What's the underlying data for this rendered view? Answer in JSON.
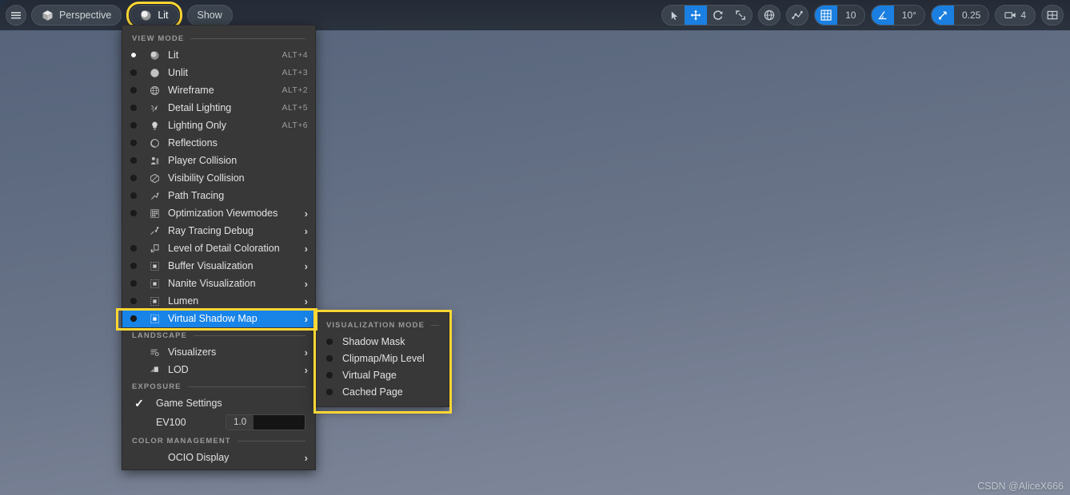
{
  "toolbar": {
    "menu_icon": "hamburger-icon",
    "perspective_label": "Perspective",
    "view_mode_label": "Lit",
    "show_label": "Show",
    "transform": {
      "select_icon": "cursor-arrow-icon",
      "move_icon": "move-gizmo-icon",
      "rotate_icon": "rotate-gizmo-icon",
      "scale_icon": "scale-gizmo-icon"
    },
    "coord_system_icon": "globe-icon",
    "surface_snap_icon": "surface-snapping-icon",
    "grid_snap": {
      "icon": "grid-icon",
      "value": "10"
    },
    "angle_snap": {
      "icon": "angle-icon",
      "value": "10°"
    },
    "scale_snap": {
      "icon": "scale-snap-icon",
      "value": "0.25"
    },
    "camera_speed": {
      "icon": "camera-icon",
      "value": "4"
    },
    "layout_icon": "viewport-layout-icon"
  },
  "view_menu": {
    "sections": [
      {
        "id": "view_mode",
        "title": "VIEW MODE"
      },
      {
        "id": "landscape",
        "title": "LANDSCAPE"
      },
      {
        "id": "exposure",
        "title": "EXPOSURE"
      },
      {
        "id": "color_management",
        "title": "COLOR MANAGEMENT"
      }
    ],
    "view_mode_items": [
      {
        "label": "Lit",
        "shortcut": "ALT+4",
        "icon": "lit-sphere-icon",
        "radio": true,
        "selected": true,
        "submenu": false
      },
      {
        "label": "Unlit",
        "shortcut": "ALT+3",
        "icon": "unlit-sphere-icon",
        "radio": true,
        "selected": false,
        "submenu": false
      },
      {
        "label": "Wireframe",
        "shortcut": "ALT+2",
        "icon": "wireframe-globe-icon",
        "radio": true,
        "selected": false,
        "submenu": false
      },
      {
        "label": "Detail Lighting",
        "shortcut": "ALT+5",
        "icon": "detail-lighting-icon",
        "radio": true,
        "selected": false,
        "submenu": false
      },
      {
        "label": "Lighting Only",
        "shortcut": "ALT+6",
        "icon": "lightbulb-icon",
        "radio": true,
        "selected": false,
        "submenu": false
      },
      {
        "label": "Reflections",
        "shortcut": "",
        "icon": "reflections-icon",
        "radio": true,
        "selected": false,
        "submenu": false
      },
      {
        "label": "Player Collision",
        "shortcut": "",
        "icon": "player-collision-icon",
        "radio": true,
        "selected": false,
        "submenu": false
      },
      {
        "label": "Visibility Collision",
        "shortcut": "",
        "icon": "visibility-collision-icon",
        "radio": true,
        "selected": false,
        "submenu": false
      },
      {
        "label": "Path Tracing",
        "shortcut": "",
        "icon": "path-tracing-icon",
        "radio": true,
        "selected": false,
        "submenu": false
      },
      {
        "label": "Optimization Viewmodes",
        "shortcut": "",
        "icon": "optimization-grid-icon",
        "radio": true,
        "selected": false,
        "submenu": true
      },
      {
        "label": "Ray Tracing Debug",
        "shortcut": "",
        "icon": "ray-tracing-icon",
        "radio": false,
        "selected": false,
        "submenu": true
      },
      {
        "label": "Level of Detail Coloration",
        "shortcut": "",
        "icon": "lod-coloration-icon",
        "radio": true,
        "selected": false,
        "submenu": true
      },
      {
        "label": "Buffer Visualization",
        "shortcut": "",
        "icon": "buffer-visualization-icon",
        "radio": true,
        "selected": false,
        "submenu": true
      },
      {
        "label": "Nanite Visualization",
        "shortcut": "",
        "icon": "nanite-visualization-icon",
        "radio": true,
        "selected": false,
        "submenu": true
      },
      {
        "label": "Lumen",
        "shortcut": "",
        "icon": "lumen-icon",
        "radio": true,
        "selected": false,
        "submenu": true
      },
      {
        "label": "Virtual Shadow Map",
        "shortcut": "",
        "icon": "virtual-shadow-map-icon",
        "radio": true,
        "selected": true,
        "submenu": true
      }
    ],
    "landscape_items": [
      {
        "label": "Visualizers",
        "icon": "visualizers-icon",
        "submenu": true
      },
      {
        "label": "LOD",
        "icon": "lod-icon",
        "submenu": true
      }
    ],
    "exposure": {
      "game_settings_label": "Game Settings",
      "game_settings_checked": true,
      "check_glyph": "✓",
      "ev100_label": "EV100",
      "ev100_value": "1.0"
    },
    "color_management": {
      "ocio_label": "OCIO Display",
      "submenu": true
    },
    "submenu_arrow": "›"
  },
  "submenu": {
    "title": "VISUALIZATION MODE",
    "items": [
      {
        "label": "Shadow Mask",
        "selected": false
      },
      {
        "label": "Clipmap/Mip Level",
        "selected": false
      },
      {
        "label": "Virtual Page",
        "selected": false
      },
      {
        "label": "Cached Page",
        "selected": false
      }
    ]
  },
  "watermark": "CSDN @AliceX666",
  "colors": {
    "highlight_yellow": "#ffd633",
    "selection_blue": "#1884e8",
    "accent_blue": "#1a7fe0",
    "menu_bg": "#383838",
    "toolbar_bg": "#242b36"
  }
}
